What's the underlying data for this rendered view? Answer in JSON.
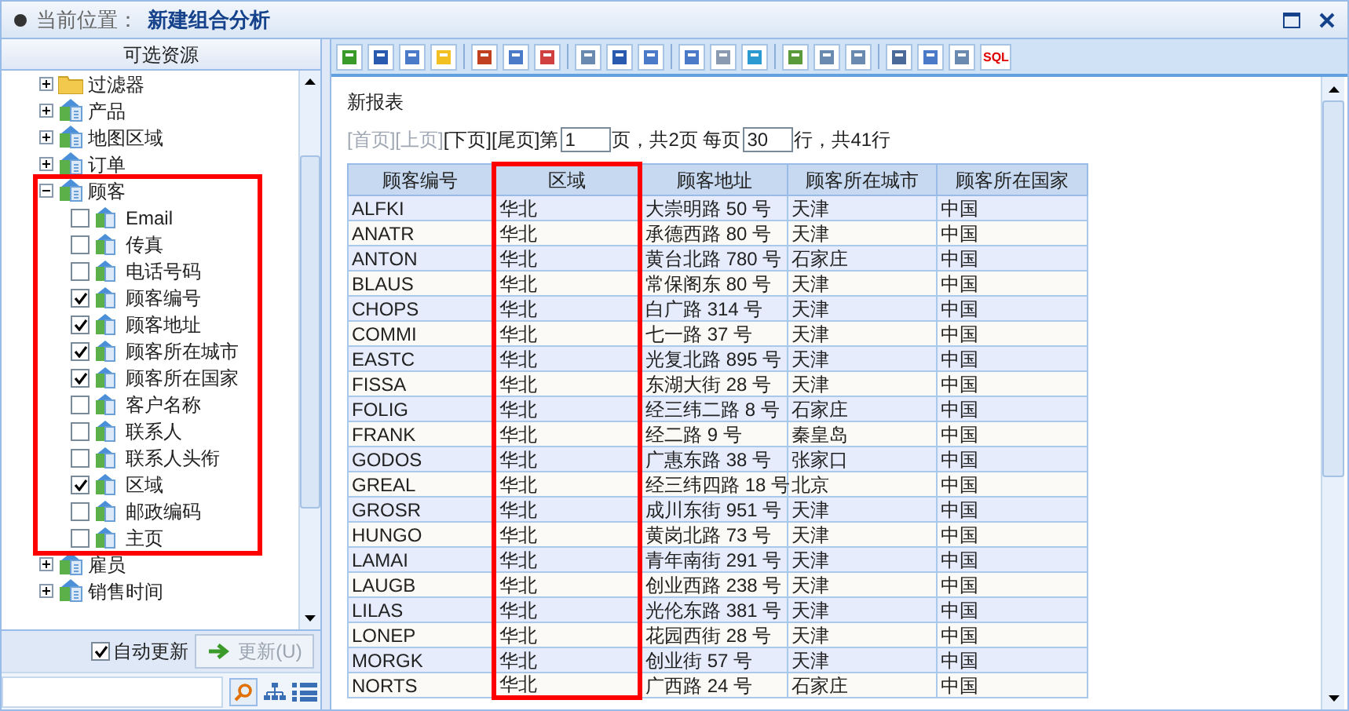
{
  "header": {
    "label": "当前位置：",
    "title": "新建组合分析"
  },
  "sidebar": {
    "title": "可选资源",
    "tree": [
      {
        "label": "过滤器",
        "kind": "folder",
        "expanded": false
      },
      {
        "label": "产品",
        "kind": "table",
        "expanded": false
      },
      {
        "label": "地图区域",
        "kind": "table",
        "expanded": false
      },
      {
        "label": "订单",
        "kind": "table",
        "expanded": false
      },
      {
        "label": "顾客",
        "kind": "table",
        "expanded": true,
        "children": [
          {
            "label": "Email",
            "checked": false
          },
          {
            "label": "传真",
            "checked": false
          },
          {
            "label": "电话号码",
            "checked": false
          },
          {
            "label": "顾客编号",
            "checked": true
          },
          {
            "label": "顾客地址",
            "checked": true
          },
          {
            "label": "顾客所在城市",
            "checked": true
          },
          {
            "label": "顾客所在国家",
            "checked": true
          },
          {
            "label": "客户名称",
            "checked": false
          },
          {
            "label": "联系人",
            "checked": false
          },
          {
            "label": "联系人头衔",
            "checked": false
          },
          {
            "label": "区域",
            "checked": true
          },
          {
            "label": "邮政编码",
            "checked": false
          },
          {
            "label": "主页",
            "checked": false
          }
        ]
      },
      {
        "label": "雇员",
        "kind": "table",
        "expanded": false
      },
      {
        "label": "销售时间",
        "kind": "table",
        "expanded": false
      }
    ],
    "auto_update": {
      "label": "自动更新",
      "checked": true
    },
    "update_button": {
      "label": "更新(U)",
      "disabled": true
    }
  },
  "toolbar": {
    "sql_label": "SQL"
  },
  "report": {
    "title": "新报表",
    "pager": {
      "links": [
        {
          "label": "[首页]",
          "disabled": true
        },
        {
          "label": "[上页]",
          "disabled": true
        },
        {
          "label": "[下页]",
          "disabled": false
        },
        {
          "label": "[尾页]",
          "disabled": false
        }
      ],
      "prefix": "第",
      "page": "1",
      "middle": "页，共2页 每页",
      "per_page": "30",
      "suffix": "行，共41行"
    },
    "table": {
      "columns": [
        {
          "label": "顾客编号",
          "highlighted": false
        },
        {
          "label": "区域",
          "highlighted": true
        },
        {
          "label": "顾客地址",
          "highlighted": false
        },
        {
          "label": "顾客所在城市",
          "highlighted": false
        },
        {
          "label": "顾客所在国家",
          "highlighted": false
        }
      ],
      "rows": [
        [
          "ALFKI",
          "华北",
          "大崇明路 50 号",
          "天津",
          "中国"
        ],
        [
          "ANATR",
          "华北",
          "承德西路 80 号",
          "天津",
          "中国"
        ],
        [
          "ANTON",
          "华北",
          "黄台北路 780 号",
          "石家庄",
          "中国"
        ],
        [
          "BLAUS",
          "华北",
          "常保阁东 80 号",
          "天津",
          "中国"
        ],
        [
          "CHOPS",
          "华北",
          "白广路 314 号",
          "天津",
          "中国"
        ],
        [
          "COMMI",
          "华北",
          "七一路 37 号",
          "天津",
          "中国"
        ],
        [
          "EASTC",
          "华北",
          "光复北路 895 号",
          "天津",
          "中国"
        ],
        [
          "FISSA",
          "华北",
          "东湖大街 28 号",
          "天津",
          "中国"
        ],
        [
          "FOLIG",
          "华北",
          "经三纬二路 8 号",
          "石家庄",
          "中国"
        ],
        [
          "FRANK",
          "华北",
          "经二路 9 号",
          "秦皇岛",
          "中国"
        ],
        [
          "GODOS",
          "华北",
          "广惠东路 38 号",
          "张家口",
          "中国"
        ],
        [
          "GREAL",
          "华北",
          "经三纬四路 18 号",
          "北京",
          "中国"
        ],
        [
          "GROSR",
          "华北",
          "成川东街 951 号",
          "天津",
          "中国"
        ],
        [
          "HUNGO",
          "华北",
          "黄岗北路 73 号",
          "天津",
          "中国"
        ],
        [
          "LAMAI",
          "华北",
          "青年南街 291 号",
          "天津",
          "中国"
        ],
        [
          "LAUGB",
          "华北",
          "创业西路 238 号",
          "天津",
          "中国"
        ],
        [
          "LILAS",
          "华北",
          "光伦东路 381 号",
          "天津",
          "中国"
        ],
        [
          "LONEP",
          "华北",
          "花园西街 28 号",
          "天津",
          "中国"
        ],
        [
          "MORGK",
          "华北",
          "创业街 57 号",
          "天津",
          "中国"
        ],
        [
          "NORTS",
          "华北",
          "广西路 24 号",
          "石家庄",
          "中国"
        ]
      ]
    }
  }
}
